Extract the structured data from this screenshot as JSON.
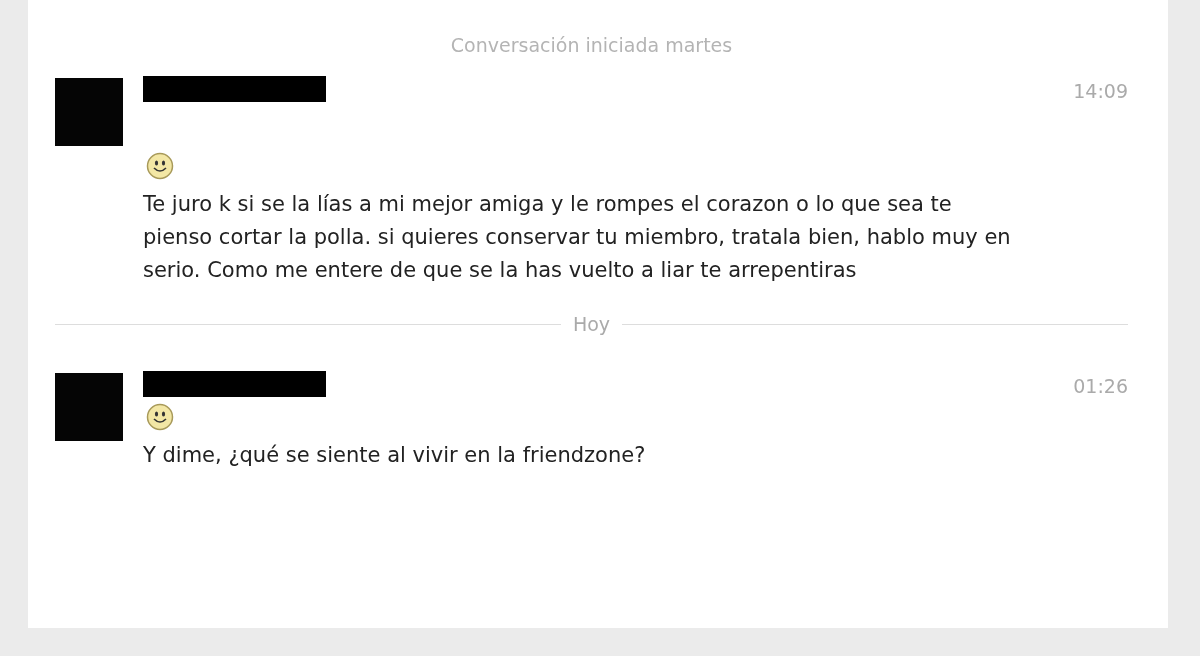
{
  "header": "Conversación iniciada martes",
  "messages": [
    {
      "time": "14:09",
      "text": "Te juro k si se la lías a mi mejor amiga y le rompes el corazon o lo que sea te pienso cortar la polla. si quieres conservar tu miembro, tratala bien, hablo muy en serio. Como me entere de que se la has vuelto a liar te arrepentiras",
      "divider_after": "Hoy"
    },
    {
      "time": "01:26",
      "text": "Y dime, ¿qué se siente al vivir en la friendzone?"
    }
  ]
}
